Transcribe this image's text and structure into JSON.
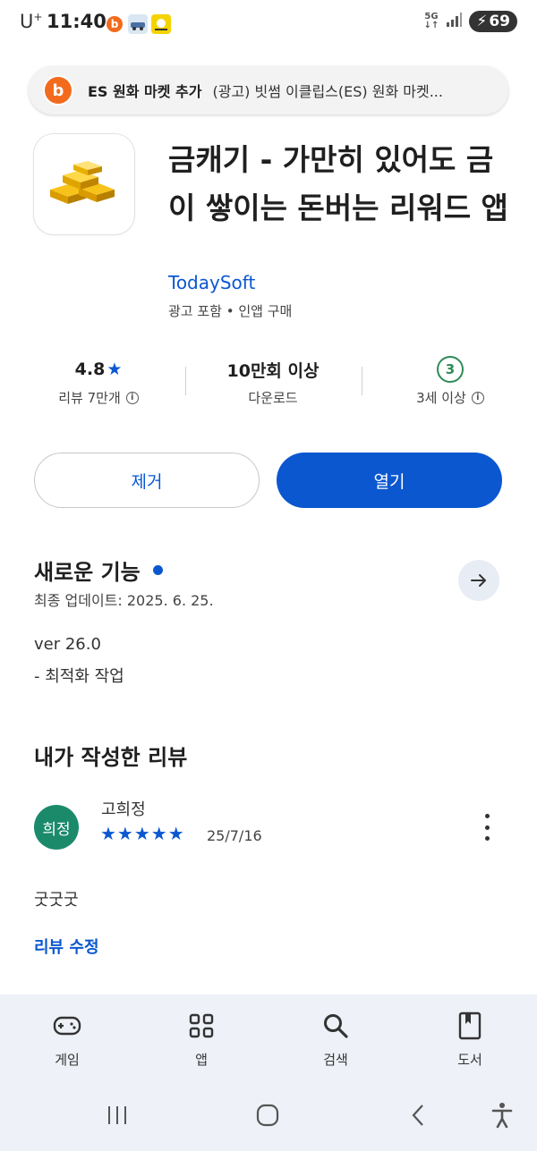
{
  "status_bar": {
    "carrier": "U",
    "carrier_sup": "+",
    "time": "11:40",
    "network": "5G",
    "battery": "69"
  },
  "ad_banner": {
    "title": "ES 원화 마켓 추가",
    "text": "(광고) 빗썸 이클립스(ES) 원화 마켓..."
  },
  "app": {
    "title": "금캐기 - 가만히 있어도 금이 쌓이는 돈버는 리워드 앱",
    "developer": "TodaySoft",
    "meta": "광고 포함 • 인앱 구매"
  },
  "stats": {
    "rating": "4.8",
    "rating_star": "★",
    "reviews": "리뷰 7만개",
    "downloads": "10만회 이상",
    "downloads_label": "다운로드",
    "age_badge": "3",
    "age_label": "3세 이상"
  },
  "buttons": {
    "remove": "제거",
    "open": "열기"
  },
  "whats_new": {
    "title": "새로운 기능",
    "updated": "최종 업데이트: 2025. 6. 25.",
    "version": "ver 26.0",
    "change": "- 최적화 작업"
  },
  "review": {
    "section_title": "내가 작성한 리뷰",
    "avatar_text": "희정",
    "reviewer": "고희정",
    "stars": "★★★★★",
    "rating_value": 5,
    "date": "25/7/16",
    "text": "굿굿굿",
    "edit_label": "리뷰 수정"
  },
  "bottom_nav": {
    "items": [
      {
        "label": "게임",
        "icon": "gamepad-icon"
      },
      {
        "label": "앱",
        "icon": "apps-grid-icon"
      },
      {
        "label": "검색",
        "icon": "search-icon"
      },
      {
        "label": "도서",
        "icon": "book-icon"
      }
    ]
  },
  "colors": {
    "accent": "#0b57d0",
    "age_badge": "#2e8b57",
    "avatar": "#1b8a6b",
    "nav_bg": "#eef1f7"
  }
}
